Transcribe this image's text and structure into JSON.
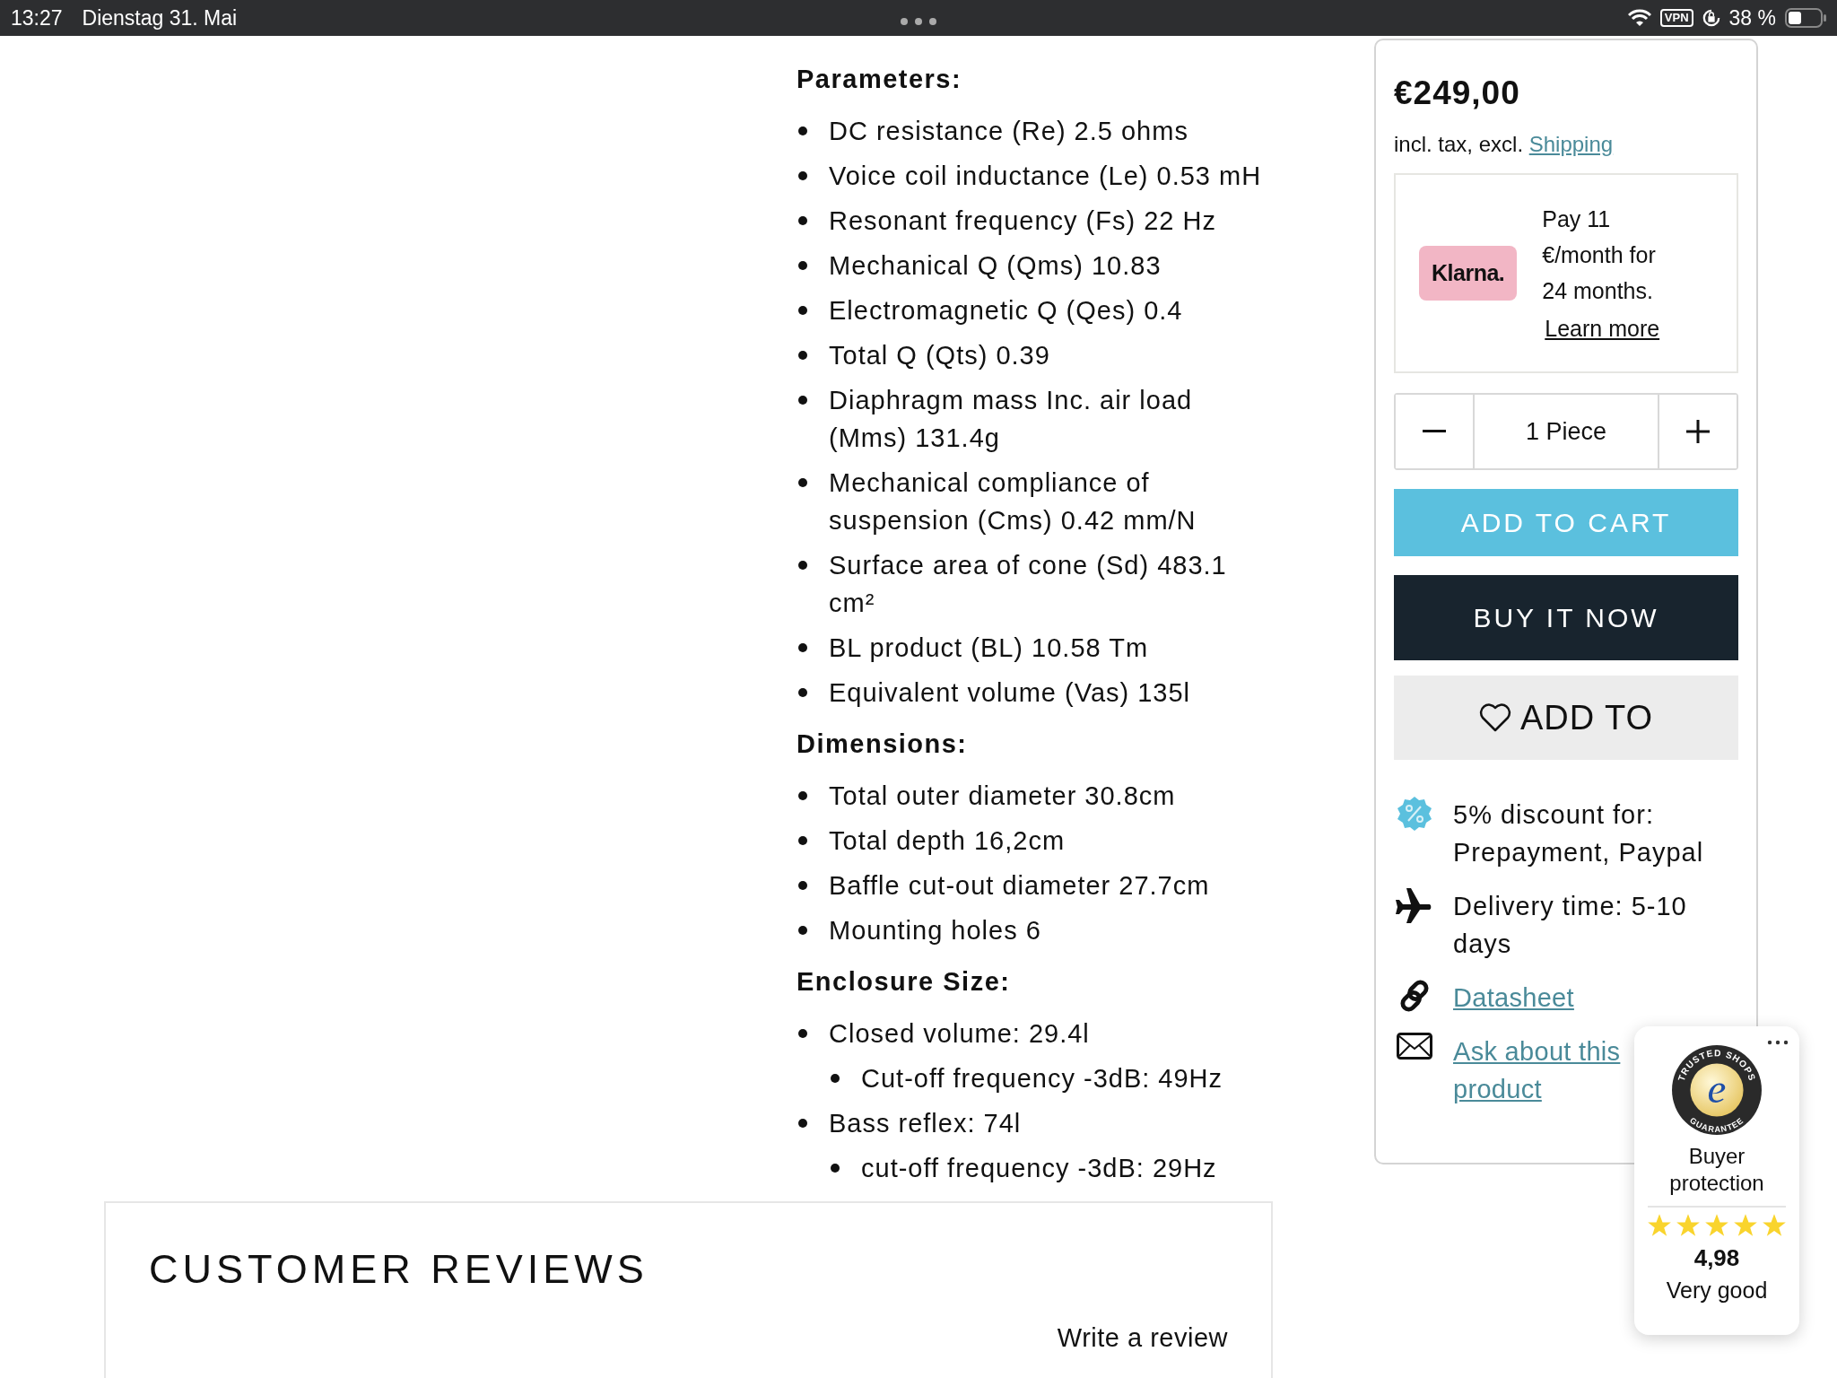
{
  "status_bar": {
    "time": "13:27",
    "date": "Dienstag 31. Mai",
    "vpn": "VPN",
    "battery": "38 %"
  },
  "sections": [
    {
      "heading": "Parameters:",
      "items": [
        {
          "text": "DC resistance (Re) 2.5 ohms"
        },
        {
          "text": "Voice coil inductance (Le) 0.53 mH"
        },
        {
          "text": "Resonant frequency (Fs) 22 Hz"
        },
        {
          "text": "Mechanical Q (Qms) 10.83"
        },
        {
          "text": "Electromagnetic Q (Qes) 0.4"
        },
        {
          "text": "Total Q (Qts) 0.39"
        },
        {
          "text": "Diaphragm mass Inc. air load (Mms) 131.4g"
        },
        {
          "text": "Mechanical compliance of suspension (Cms) 0.42 mm/N"
        },
        {
          "text": "Surface area of cone (Sd) 483.1 cm²"
        },
        {
          "text": "BL product (BL) 10.58 Tm"
        },
        {
          "text": "Equivalent volume (Vas) 135l"
        }
      ]
    },
    {
      "heading": "Dimensions:",
      "items": [
        {
          "text": "Total outer diameter 30.8cm"
        },
        {
          "text": "Total depth 16,2cm"
        },
        {
          "text": "Baffle cut-out diameter 27.7cm"
        },
        {
          "text": "Mounting holes 6"
        }
      ]
    },
    {
      "heading": "Enclosure Size:",
      "items": [
        {
          "text": "Closed volume: 29.4l",
          "children": [
            {
              "text": "Cut-off frequency -3dB: 49Hz"
            }
          ]
        },
        {
          "text": "Bass reflex: 74l",
          "children": [
            {
              "text": "cut-off frequency -3dB: 29Hz"
            }
          ]
        }
      ]
    }
  ],
  "buy_box": {
    "price": "€249,00",
    "tax_note": "incl. tax, excl.",
    "shipping_link": "Shipping",
    "klarna": {
      "logo": "Klarna.",
      "text": "Pay 11 €/month for 24 months.",
      "link": "Learn more"
    },
    "quantity": "1 Piece",
    "buttons": [
      {
        "label": "ADD TO CART",
        "kind": "cart"
      },
      {
        "label": "BUY IT NOW",
        "kind": "buy"
      },
      {
        "label": "ADD TO",
        "kind": "wishlist"
      }
    ],
    "features": [
      {
        "kind": "discount",
        "text": "5% discount for: Prepayment, Paypal"
      },
      {
        "kind": "delivery",
        "text": "Delivery time: 5-10 days"
      },
      {
        "kind": "datasheet",
        "text": "Datasheet"
      },
      {
        "kind": "ask",
        "text": "Ask about this product"
      }
    ]
  },
  "trust_badge": {
    "seal_top": "TRUSTED SHOPS",
    "seal_letter": "e",
    "seal_bottom": "GUARANTEE",
    "label": "Buyer protection",
    "stars": 5,
    "rating": "4,98",
    "verdict": "Very good"
  },
  "reviews": {
    "title": "CUSTOMER REVIEWS",
    "write_link": "Write a review"
  }
}
